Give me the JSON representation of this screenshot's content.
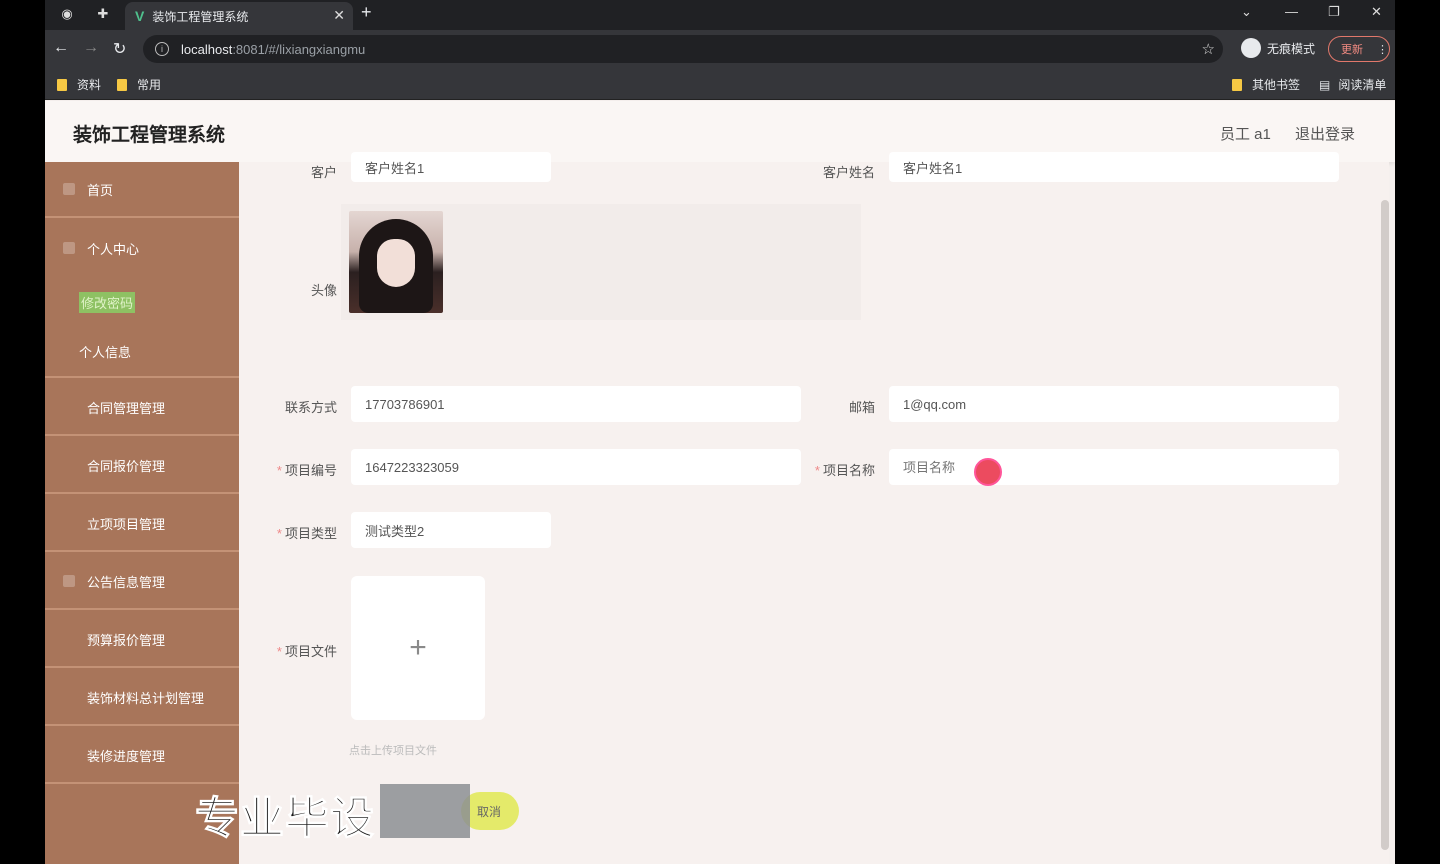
{
  "browser": {
    "tab_title": "装饰工程管理系统",
    "url_host": "localhost",
    "url_path": ":8081/#/lixiangxiangmu",
    "incognito_label": "无痕模式",
    "update_label": "更新",
    "bookmarks": [
      "资料",
      "常用"
    ],
    "other_bookmarks": "其他书签",
    "reading_list": "阅读清单"
  },
  "header": {
    "title": "装饰工程管理系统",
    "user": "员工 a1",
    "logout": "退出登录"
  },
  "sidebar": {
    "items": [
      {
        "label": "首页"
      },
      {
        "label": "个人中心"
      },
      {
        "label": "修改密码"
      },
      {
        "label": "个人信息"
      },
      {
        "label": "合同管理管理"
      },
      {
        "label": "合同报价管理"
      },
      {
        "label": "立项项目管理"
      },
      {
        "label": "公告信息管理"
      },
      {
        "label": "预算报价管理"
      },
      {
        "label": "装饰材料总计划管理"
      },
      {
        "label": "装修进度管理"
      }
    ]
  },
  "form": {
    "customer_label": "客户",
    "customer_value": "客户姓名1",
    "customer_name_label": "客户姓名",
    "customer_name_value": "客户姓名1",
    "avatar_label": "头像",
    "contact_label": "联系方式",
    "contact_value": "17703786901",
    "email_label": "邮箱",
    "email_value": "1@qq.com",
    "project_no_label": "项目编号",
    "project_no_value": "1647223323059",
    "project_name_label": "项目名称",
    "project_name_placeholder": "项目名称",
    "project_type_label": "项目类型",
    "project_type_value": "测试类型2",
    "project_file_label": "项目文件",
    "upload_plus": "+",
    "upload_hint": "点击上传项目文件",
    "cancel_label": "取消"
  },
  "overlay": {
    "watermark": "专业毕设"
  }
}
